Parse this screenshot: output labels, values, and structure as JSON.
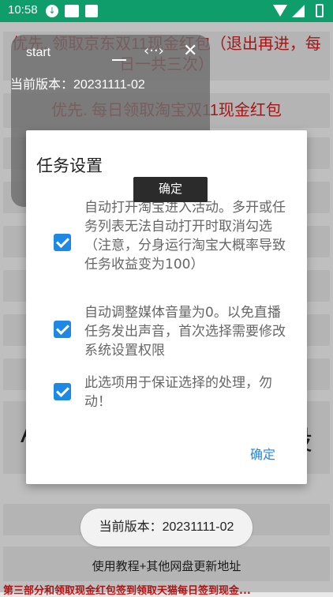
{
  "status_bar": {
    "time": "10:58"
  },
  "background": {
    "promo1": "优先. 领取京东双11现金红包（退出再进，每日一共三次）",
    "promo2": "优先. 每日领取淘宝双11现金红包",
    "big_left": "A",
    "big_right": "设",
    "bottom_link": "使用教程+其他网盘更新地址",
    "bottom_red": "第三部分和领取现金红包签到领取天猫每日签到现金..."
  },
  "float_window": {
    "title": "start",
    "version": "当前版本：20231111-02",
    "heading": "任务设置",
    "ok_label": "确定"
  },
  "dialog": {
    "options": [
      {
        "text": "自动打开淘宝进入活动。多开或任务列表无法自动打开时取消勾选（注意，分身运行淘宝大概率导致任务收益变为100）",
        "checked": true
      },
      {
        "text": "自动调整媒体音量为0。以免直播任务发出声音，首次选择需要修改系统设置权限",
        "checked": true
      },
      {
        "text": "此选项用于保证选择的处理，勿动！",
        "checked": true
      }
    ],
    "ok_label": "确定"
  },
  "toast": {
    "text": "当前版本：20231111-02"
  },
  "colors": {
    "status_bar": "#0f9d6b",
    "accent": "#1e88e5",
    "promo_red": "#cc1b1b"
  }
}
